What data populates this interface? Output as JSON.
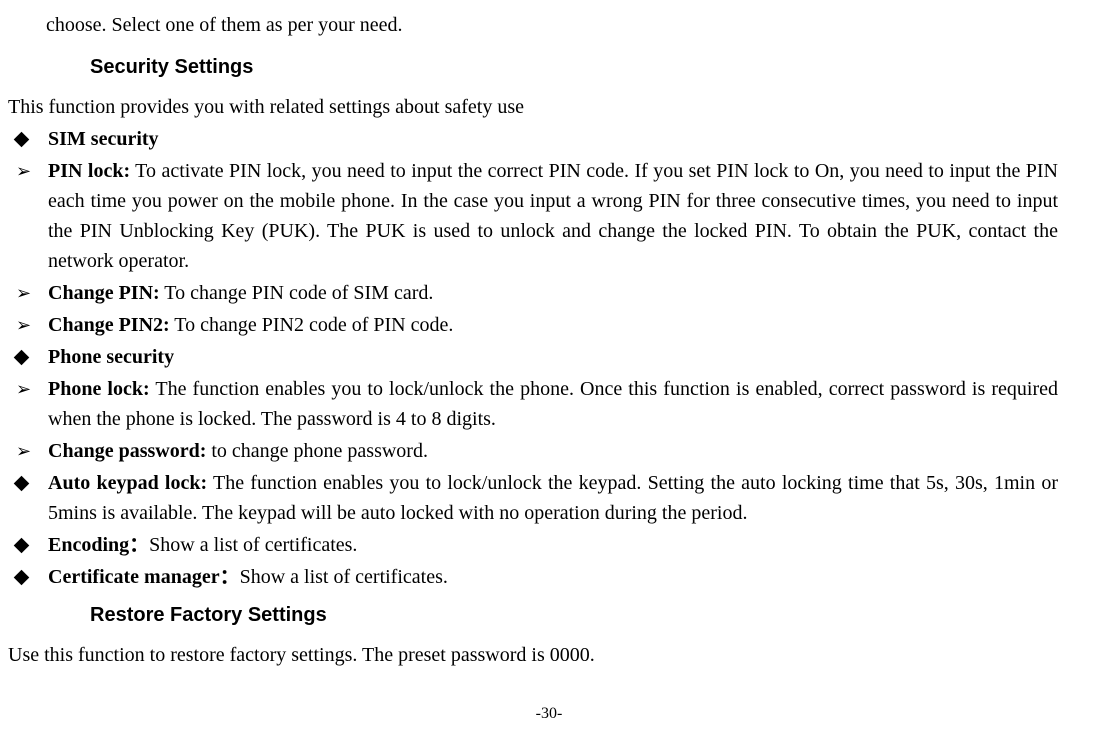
{
  "intro": "choose. Select one of them as per your need.",
  "section1": {
    "heading": "Security Settings",
    "description": "This function provides you with related settings about safety use"
  },
  "items": {
    "sim_security": "SIM security",
    "pin_lock_label": "PIN lock:",
    "pin_lock_text": " To activate PIN lock, you need to input the correct PIN code. If you set PIN lock to On, you need to input the PIN each time you power on the mobile phone. In the case you input a wrong PIN for three consecutive times, you need to input the PIN Unblocking Key (PUK). The PUK is used to unlock and change the locked PIN. To obtain the PUK, contact the network operator.",
    "change_pin_label": "Change PIN:",
    "change_pin_text": " To change PIN code of SIM card.",
    "change_pin2_label": "Change PIN2:",
    "change_pin2_text": " To change PIN2 code of PIN code.",
    "phone_security": "Phone security",
    "phone_lock_label": "Phone lock:",
    "phone_lock_text": " The function enables you to lock/unlock the phone. Once this function is enabled, correct password is required when the phone is locked. The password is 4 to 8 digits.",
    "change_password_label": "Change password:",
    "change_password_text": " to change phone password.",
    "auto_keypad_label": "Auto keypad lock:",
    "auto_keypad_text": " The function enables you to lock/unlock the keypad. Setting the auto locking time that 5s, 30s, 1min or 5mins is available. The keypad will be auto locked with no operation during the period.",
    "encoding_label": "Encoding：",
    "encoding_text": "Show a list of certificates.",
    "cert_manager_label": "Certificate manager：",
    "cert_manager_text": "Show a list of certificates."
  },
  "section2": {
    "heading": "Restore Factory Settings",
    "description": "Use this function to restore factory settings. The preset password is 0000."
  },
  "page_number": "-30-"
}
